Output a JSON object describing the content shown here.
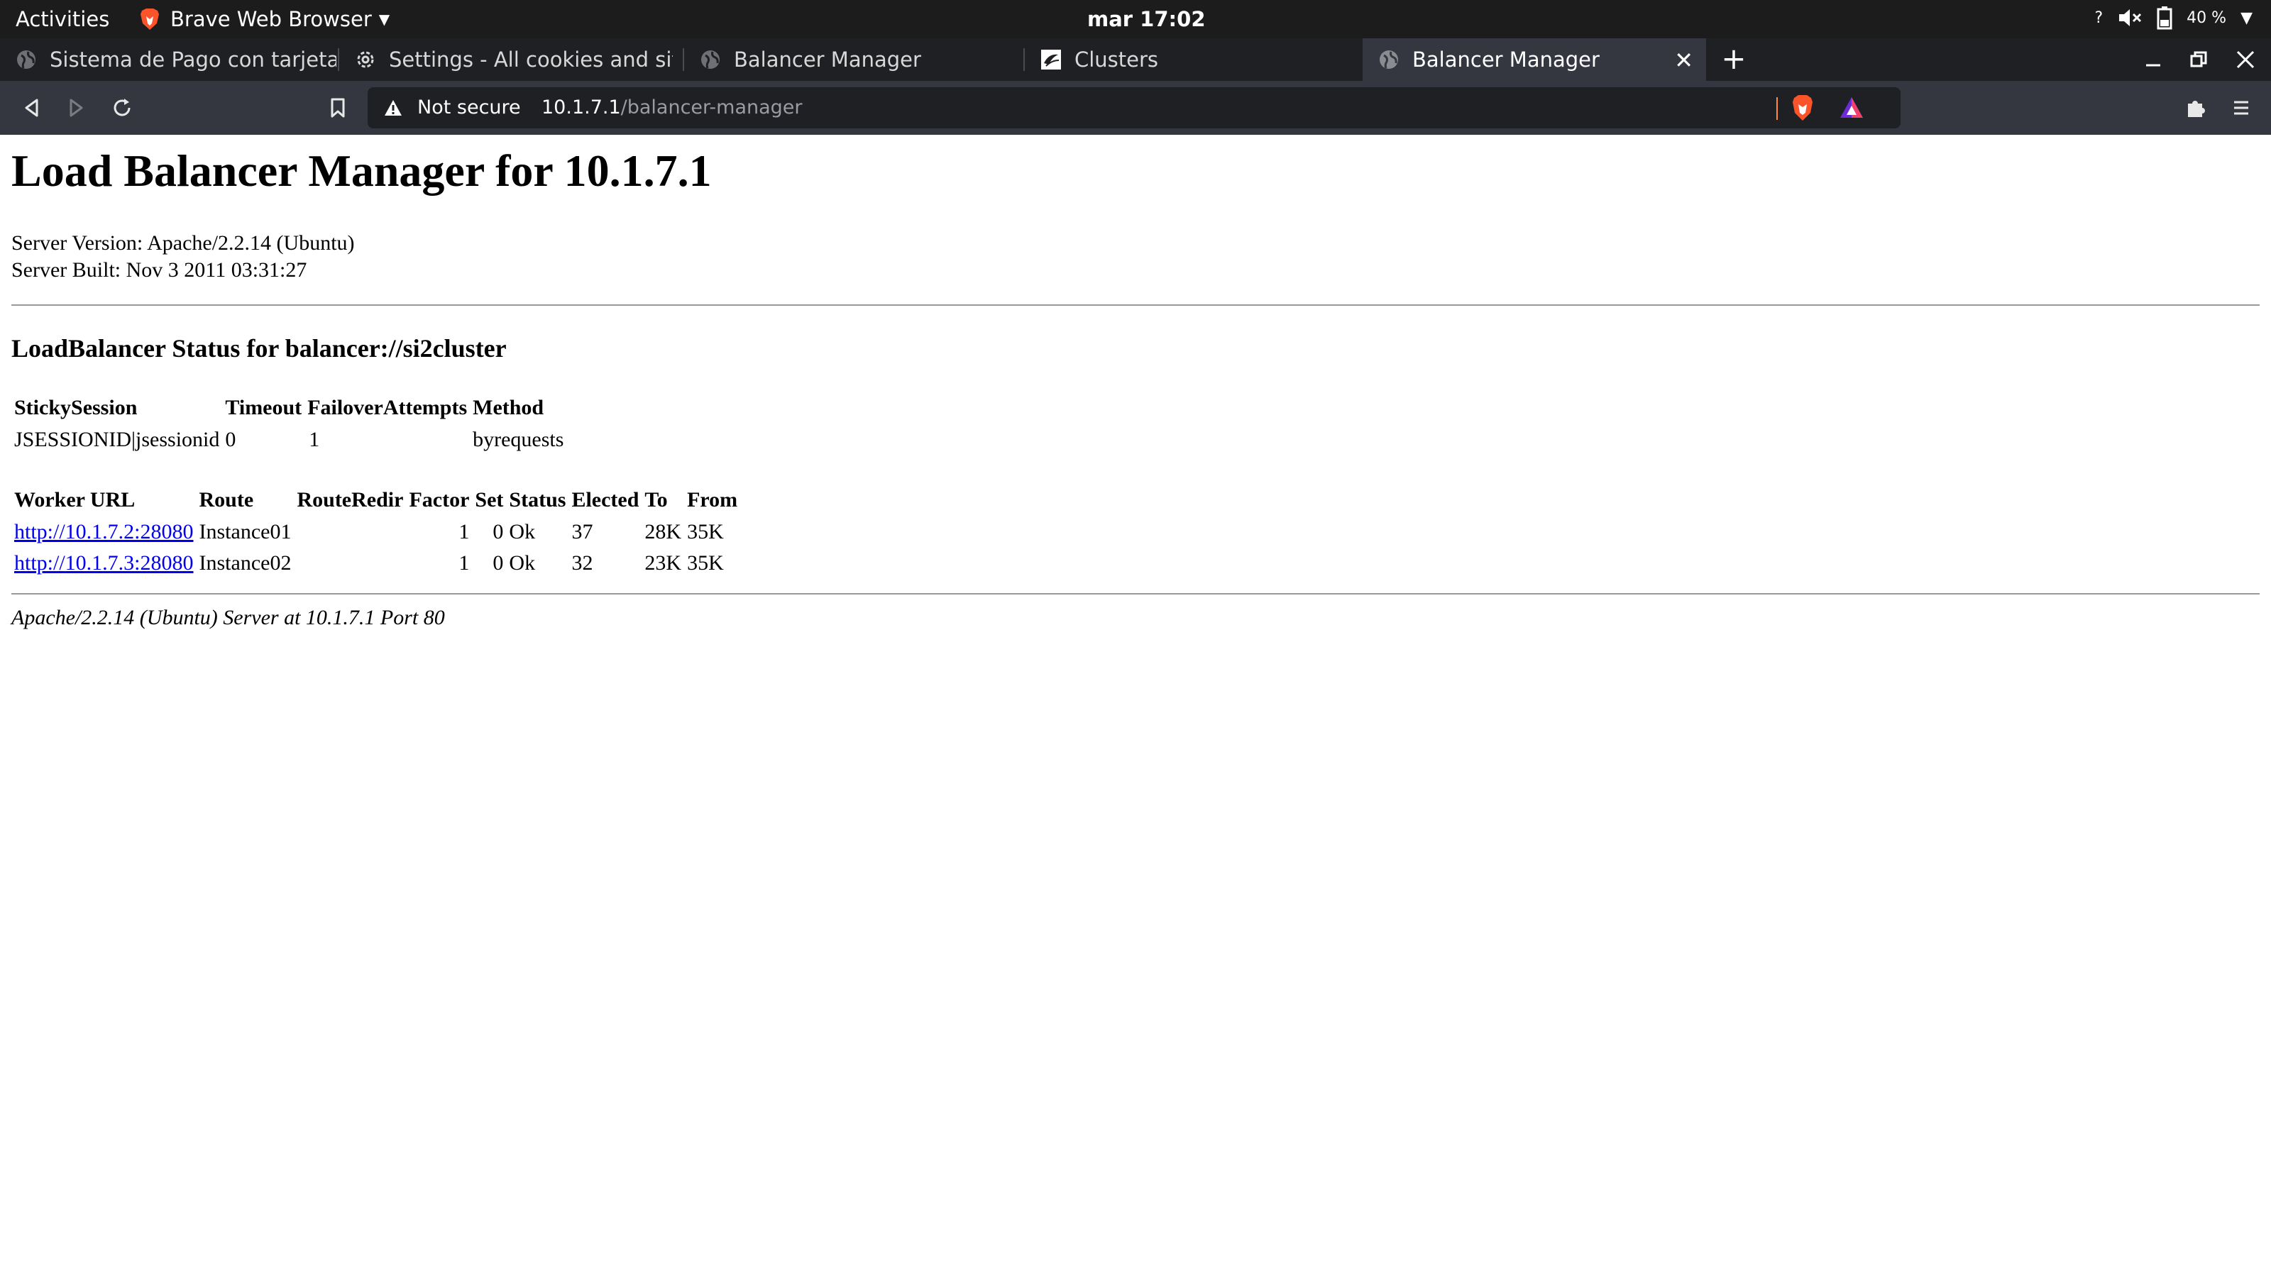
{
  "topbar": {
    "activities": "Activities",
    "app_name": "Brave Web Browser",
    "clock": "mar 17:02",
    "help": "?",
    "battery": "40 %"
  },
  "tabs": [
    {
      "label": "Sistema de Pago con tarjeta",
      "icon": "globe-icon"
    },
    {
      "label": "Settings - All cookies and site",
      "icon": "gear-icon"
    },
    {
      "label": "Balancer Manager",
      "icon": "globe-icon"
    },
    {
      "label": "Clusters",
      "icon": "glassfish-icon"
    },
    {
      "label": "Balancer Manager",
      "icon": "globe-icon",
      "active": true
    }
  ],
  "toolbar": {
    "security_label": "Not secure",
    "url_host": "10.1.7.1",
    "url_path": "/balancer-manager"
  },
  "page": {
    "title": "Load Balancer Manager for 10.1.7.1",
    "server_version": "Server Version: Apache/2.2.14 (Ubuntu)",
    "server_built": "Server Built: Nov 3 2011 03:31:27",
    "balancer_heading": "LoadBalancer Status for balancer://si2cluster",
    "balancer_table": {
      "headers": [
        "StickySession",
        "Timeout",
        "FailoverAttempts",
        "Method"
      ],
      "row": [
        "JSESSIONID|jsessionid",
        "0",
        "1",
        "byrequests"
      ]
    },
    "workers_table": {
      "headers": [
        "Worker URL",
        "Route",
        "RouteRedir",
        "Factor",
        "Set",
        "Status",
        "Elected",
        "To",
        "From"
      ],
      "rows": [
        [
          "http://10.1.7.2:28080",
          "Instance01",
          "",
          "1",
          "0",
          "Ok",
          "37",
          "28K",
          "35K"
        ],
        [
          "http://10.1.7.3:28080",
          "Instance02",
          "",
          "1",
          "0",
          "Ok",
          "32",
          "23K",
          "35K"
        ]
      ]
    },
    "footer": "Apache/2.2.14 (Ubuntu) Server at 10.1.7.1 Port 80"
  }
}
